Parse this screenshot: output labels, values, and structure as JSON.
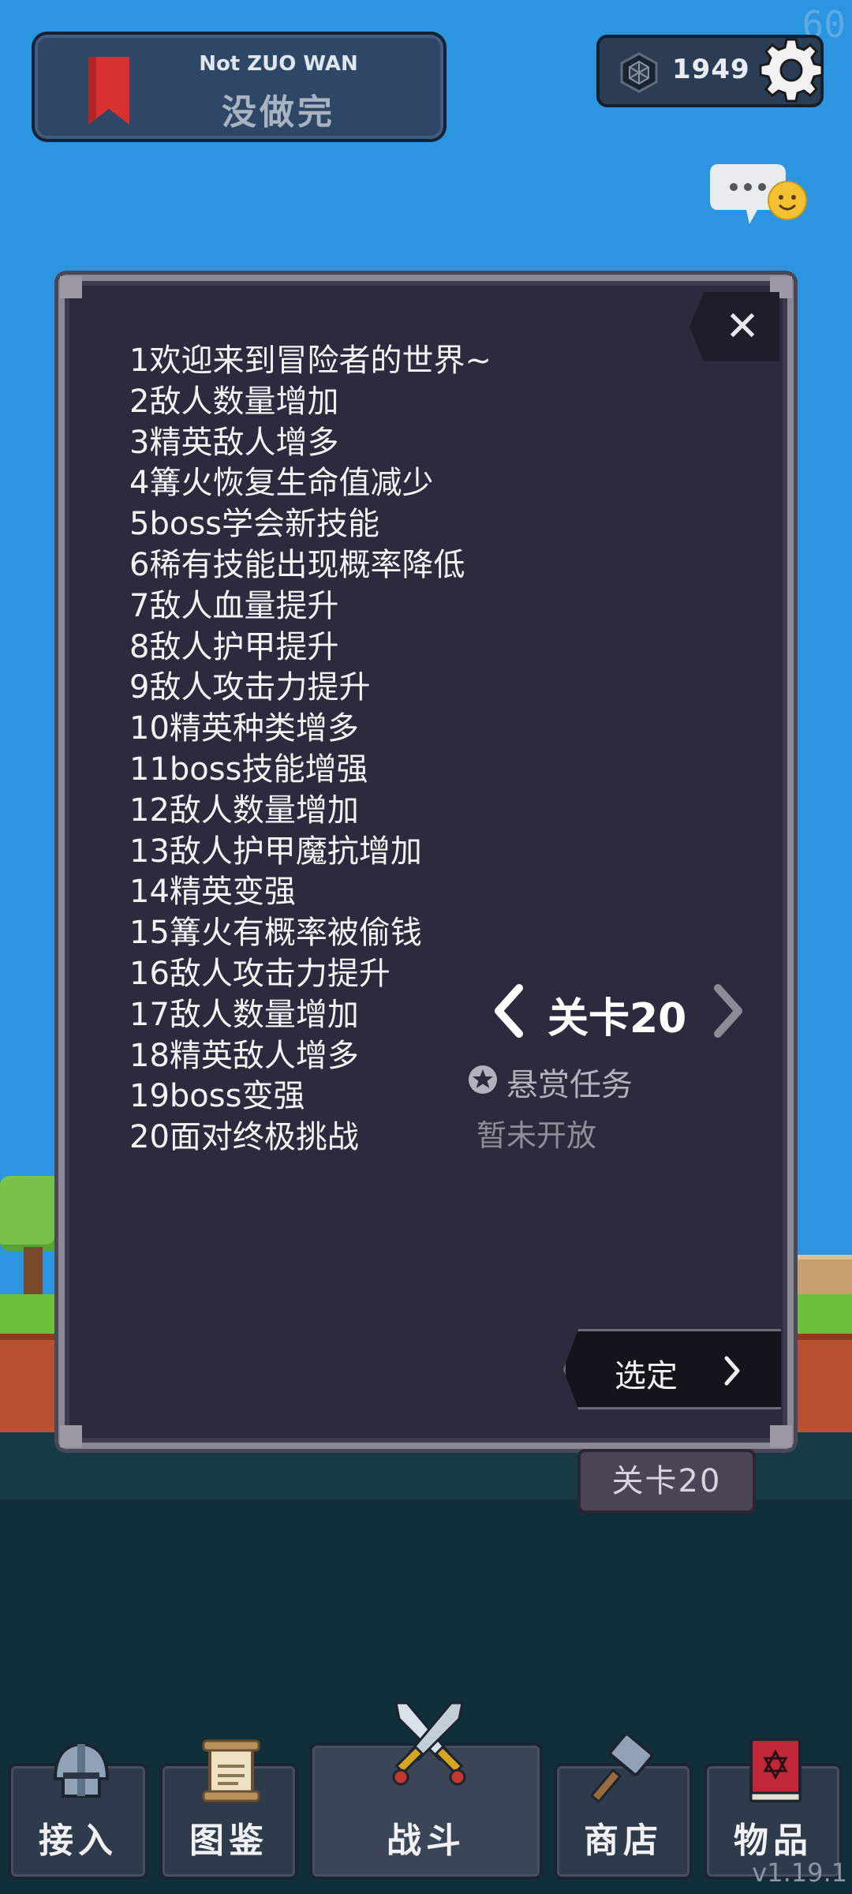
{
  "status": {
    "fps": "60",
    "version": "v1.19.1"
  },
  "save_banner": {
    "subtitle": "Not ZUO WAN",
    "title": "没做完"
  },
  "currency": {
    "value": "1949"
  },
  "icons": {
    "bookmark": "bookmark-icon",
    "gem": "gem-icon",
    "gear": "gear-icon",
    "chat": "chat-bubble-icon",
    "close": "close-icon",
    "star_badge": "star-badge-icon",
    "chevron_left": "chevron-left-icon",
    "chevron_right": "chevron-right-icon",
    "helmet": "helmet-icon",
    "scroll": "scroll-icon",
    "swords": "crossed-swords-icon",
    "hammer": "hammer-icon",
    "spellbook": "spellbook-icon"
  },
  "panel": {
    "close_label": "✕",
    "rules": [
      "1欢迎来到冒险者的世界~",
      "2敌人数量增加",
      "3精英敌人增多",
      "4篝火恢复生命值减少",
      "5boss学会新技能",
      "6稀有技能出现概率降低",
      "7敌人血量提升",
      "8敌人护甲提升",
      "9敌人攻击力提升",
      "10精英种类增多",
      "11boss技能增强",
      "12敌人数量增加",
      "13敌人护甲魔抗增加",
      "14精英变强",
      "15篝火有概率被偷钱",
      "16敌人攻击力提升",
      "17敌人数量增加",
      "18精英敌人增多",
      "19boss变强",
      "20面对终极挑战"
    ],
    "level_title": "关卡20",
    "bounty_label": "悬赏任务",
    "bounty_status": "暂未开放",
    "select_label": "选定"
  },
  "level_tag": "关卡20",
  "bottom_nav": [
    {
      "label": "接入",
      "icon": "helmet-icon"
    },
    {
      "label": "图鉴",
      "icon": "scroll-icon"
    },
    {
      "label": "战斗",
      "icon": "crossed-swords-icon"
    },
    {
      "label": "商店",
      "icon": "hammer-icon"
    },
    {
      "label": "物品",
      "icon": "spellbook-icon"
    }
  ],
  "colors": {
    "sky": "#2b95e0",
    "panel_bg": "#2c2a3c",
    "panel_border": "#8b8795",
    "nav_bg": "#2f3b4a",
    "bookmark": "#d8302f"
  }
}
